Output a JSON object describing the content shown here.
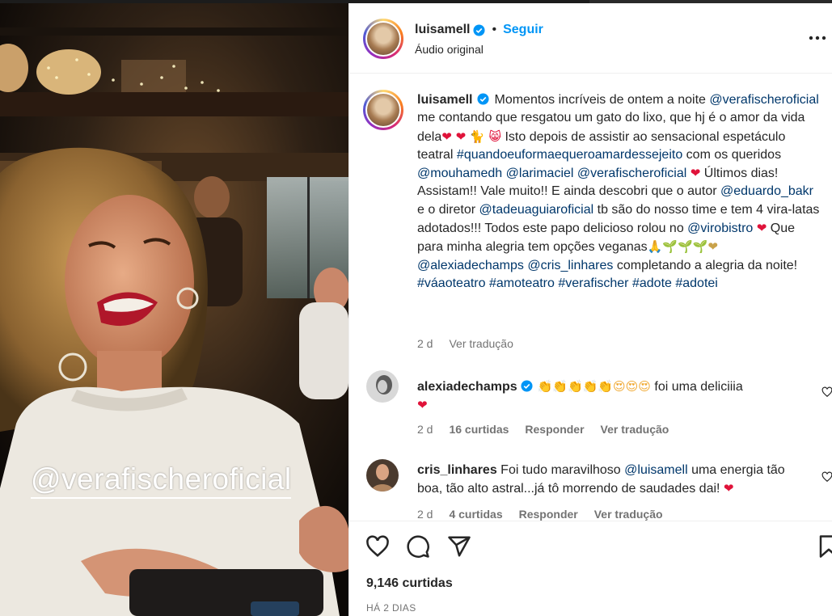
{
  "post": {
    "username": "luisamell",
    "follow_label": "Seguir",
    "separator": "•",
    "audio_label": "Áudio original",
    "media_tag": "@verafischeroficial"
  },
  "caption": {
    "username": "luisamell",
    "parts": {
      "p1": "Momentos incríveis de ontem a noite",
      "m1": "@verafischeroficial",
      "p2": " me contando que resgatou um gato do lixo, que hj é o amor da vida dela",
      "e1": "❤ ❤ 🐈 😸",
      "p3": " Isto depois de assistir ao sensacional espetáculo teatral",
      "h1": "#quandoeuformaequeroamardessejeito",
      "p4": " com os queridos",
      "m2": "@mouhamedh",
      "m3": "@larimaciel",
      "m4": "@verafischeroficial",
      "e2": "❤",
      "p5": " Últimos dias! Assistam!! Vale muito!! E ainda descobri que o autor",
      "m5": "@eduardo_bakr",
      "p6": " e o diretor",
      "m6": "@tadeuaguiaroficial",
      "p7": " tb são do nosso time e tem 4 vira-latas adotados!!! Todos este papo delicioso rolou no",
      "m7": "@virobistro",
      "e3": "❤",
      "p8": " Que para minha alegria tem opções veganas",
      "e4": "🙏🌱🌱🌱❤",
      "m8": "@alexiadechamps",
      "m9": "@cris_linhares",
      "p9": "completando a alegria da noite!",
      "h2": "#váaoteatro",
      "h3": "#amoteatro",
      "h4": "#verafischer",
      "h5": "#adote",
      "h6": "#adotei"
    },
    "time": "2 d",
    "translate": "Ver tradução"
  },
  "comments": [
    {
      "username": "alexiadechamps",
      "emojis": "👏👏👏👏👏😍😍😍",
      "text": " foi uma deliciiia",
      "emoji_end": "❤",
      "time": "2 d",
      "likes": "16 curtidas",
      "reply": "Responder",
      "translate": "Ver tradução"
    },
    {
      "username": "cris_linhares",
      "text_a": " Foi tudo maravilhoso ",
      "mention": "@luisamell",
      "text_b": " uma energia tão boa, tão alto astral...já tô morrendo de saudades dai! ",
      "emoji_end": "❤",
      "time": "2 d",
      "likes": "4 curtidas",
      "reply": "Responder",
      "translate": "Ver tradução"
    }
  ],
  "footer": {
    "likes": "9,146 curtidas",
    "when": "HÁ 2 DIAS"
  },
  "icons": [
    "heart-icon",
    "comment-icon",
    "share-icon",
    "bookmark-icon",
    "more-options-icon",
    "verified-icon"
  ],
  "colors": {
    "link": "#00376b",
    "follow": "#0095f6",
    "muted": "#737373",
    "heart": "#e0133a"
  }
}
